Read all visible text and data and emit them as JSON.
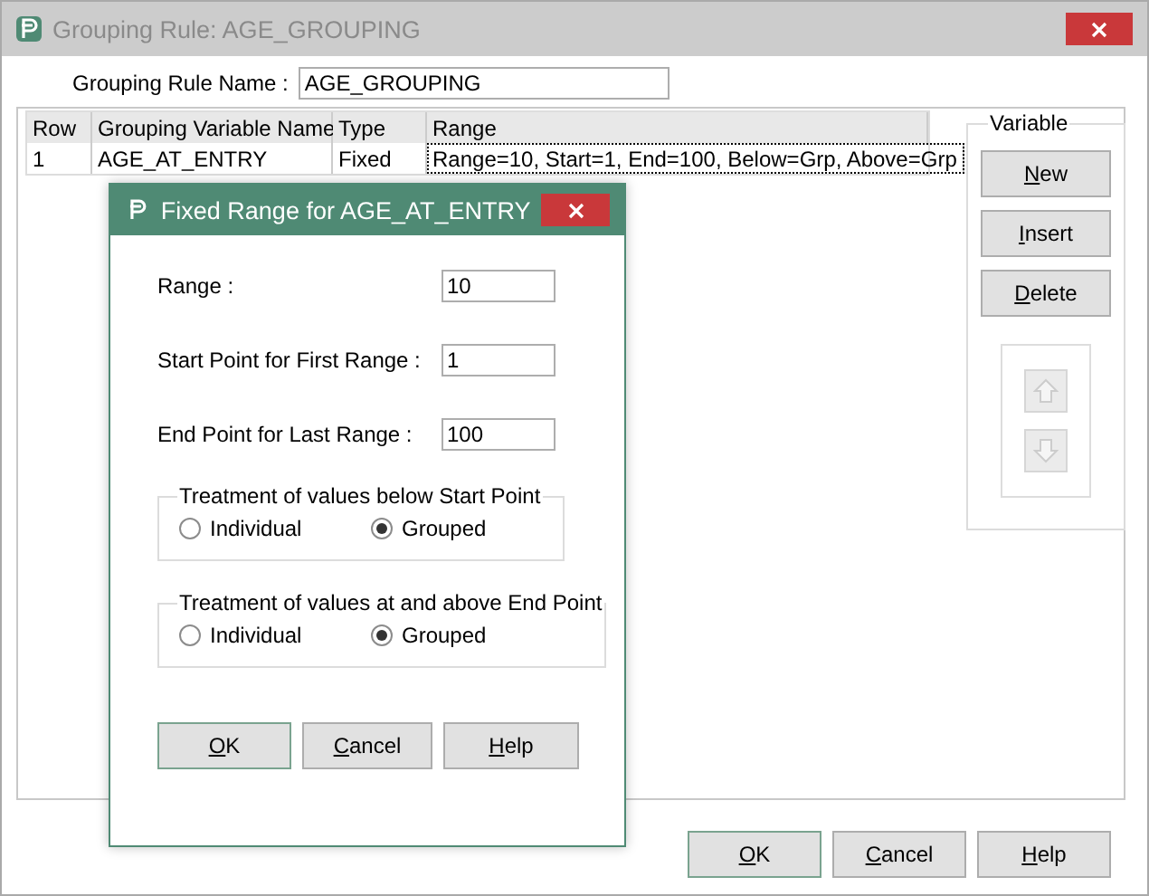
{
  "window": {
    "title": "Grouping Rule: AGE_GROUPING"
  },
  "rule_name": {
    "label": "Grouping Rule Name :",
    "value": "AGE_GROUPING"
  },
  "table": {
    "columns": [
      "Row",
      "Grouping Variable Name",
      "Type",
      "Range"
    ],
    "rows": [
      {
        "cells": [
          "1",
          "AGE_AT_ENTRY",
          "Fixed",
          "Range=10, Start=1, End=100, Below=Grp, Above=Grp"
        ]
      }
    ]
  },
  "variable_group": {
    "title": "Variable",
    "buttons": [
      {
        "label": "New",
        "mnemonic_first": true
      },
      {
        "label": "Insert",
        "mnemonic_first": true
      },
      {
        "label": "Delete",
        "mnemonic_first": true
      }
    ],
    "move_buttons": [
      {
        "kind": "up",
        "disabled": true
      },
      {
        "kind": "down",
        "disabled": true
      }
    ]
  },
  "footer_buttons": [
    {
      "label": "OK",
      "mnemonic_first": true,
      "default": true
    },
    {
      "label": "Cancel",
      "mnemonic_first": true,
      "default": false
    },
    {
      "label": "Help",
      "mnemonic_first": true,
      "default": false
    }
  ],
  "dialog": {
    "title": "Fixed Range for AGE_AT_ENTRY",
    "fields": [
      {
        "label": "Range :",
        "value": "10"
      },
      {
        "label": "Start Point for First Range :",
        "value": "1"
      },
      {
        "label": "End Point for Last Range :",
        "value": "100"
      }
    ],
    "groups": [
      {
        "title": "Treatment of values below Start Point",
        "options": [
          {
            "label": "Individual",
            "selected": false
          },
          {
            "label": "Grouped",
            "selected": true
          }
        ]
      },
      {
        "title": "Treatment of values at and above End Point",
        "options": [
          {
            "label": "Individual",
            "selected": false
          },
          {
            "label": "Grouped",
            "selected": true
          }
        ]
      }
    ],
    "buttons": [
      {
        "label": "OK",
        "mnemonic_first": true,
        "default": true
      },
      {
        "label": "Cancel",
        "mnemonic_first": true,
        "default": false
      },
      {
        "label": "Help",
        "mnemonic_first": true,
        "default": false
      }
    ]
  }
}
